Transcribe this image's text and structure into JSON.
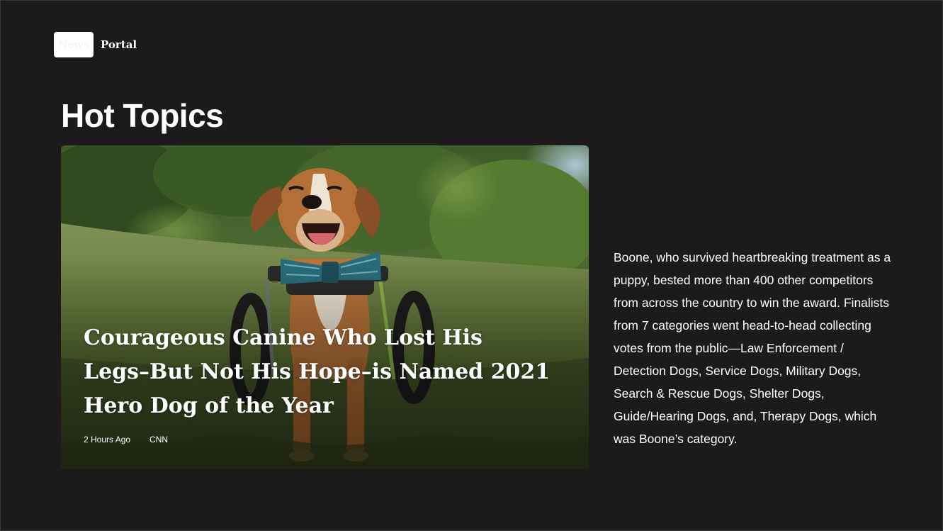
{
  "logo": {
    "box_text": "News",
    "label": "Portal"
  },
  "section": {
    "title": "Hot Topics"
  },
  "feature": {
    "image_alt": "Smiling beagle mix dog in a wheelchair with a plaid bow tie on a grassy hill",
    "title": "Courageous Canine Who Lost His Legs–But Not His Hope–is Named 2021 Hero Dog of the Year",
    "time": "2 Hours Ago",
    "source": "CNN"
  },
  "description": "Boone, who survived heartbreaking treatment as a puppy, bested more than 400 other competitors from across the country to win the award. Finalists from 7 categories went head-to-head collecting votes from the public—Law Enforcement / Detection Dogs, Service Dogs, Military Dogs, Search & Rescue Dogs, Shelter Dogs, Guide/Hearing Dogs, and, Therapy Dogs, which was Boone’s category.",
  "colors": {
    "background": "#1c1a1b",
    "text": "#ffffff",
    "logo_box": "#ffffff"
  }
}
